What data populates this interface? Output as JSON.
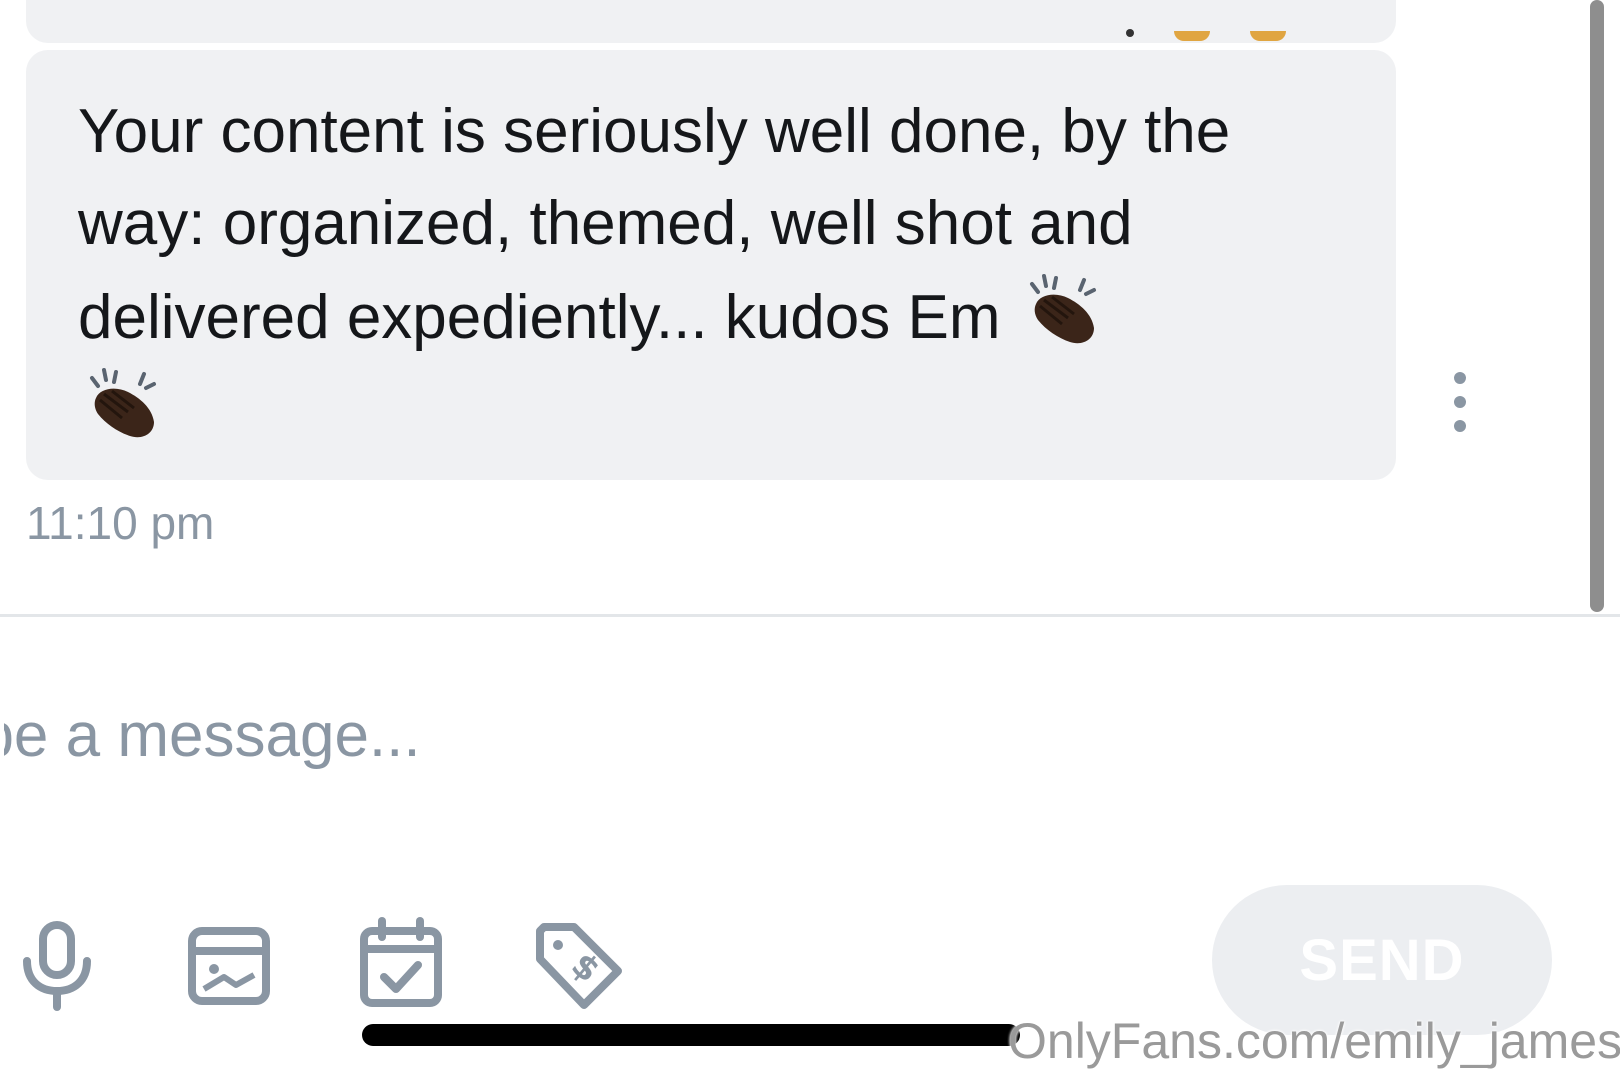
{
  "message": {
    "text": "Your content is seriously well done, by the way: organized, themed, well shot and delivered expediently... kudos Em",
    "emoji": [
      "clapping-hands-dark-skin-tone",
      "clapping-hands-dark-skin-tone"
    ],
    "timestamp": "11:10 pm"
  },
  "composer": {
    "placeholder": "Type a message...",
    "tools": [
      "microphone-icon",
      "image-icon",
      "calendar-check-icon",
      "price-tag-icon"
    ],
    "send_label": "SEND"
  },
  "watermark": "OnlyFans.com/emily_james",
  "colors": {
    "bubble_bg": "#f0f1f3",
    "muted_text": "#8a96a3",
    "icon": "#8a96a3",
    "send_bg": "#eceef1"
  }
}
